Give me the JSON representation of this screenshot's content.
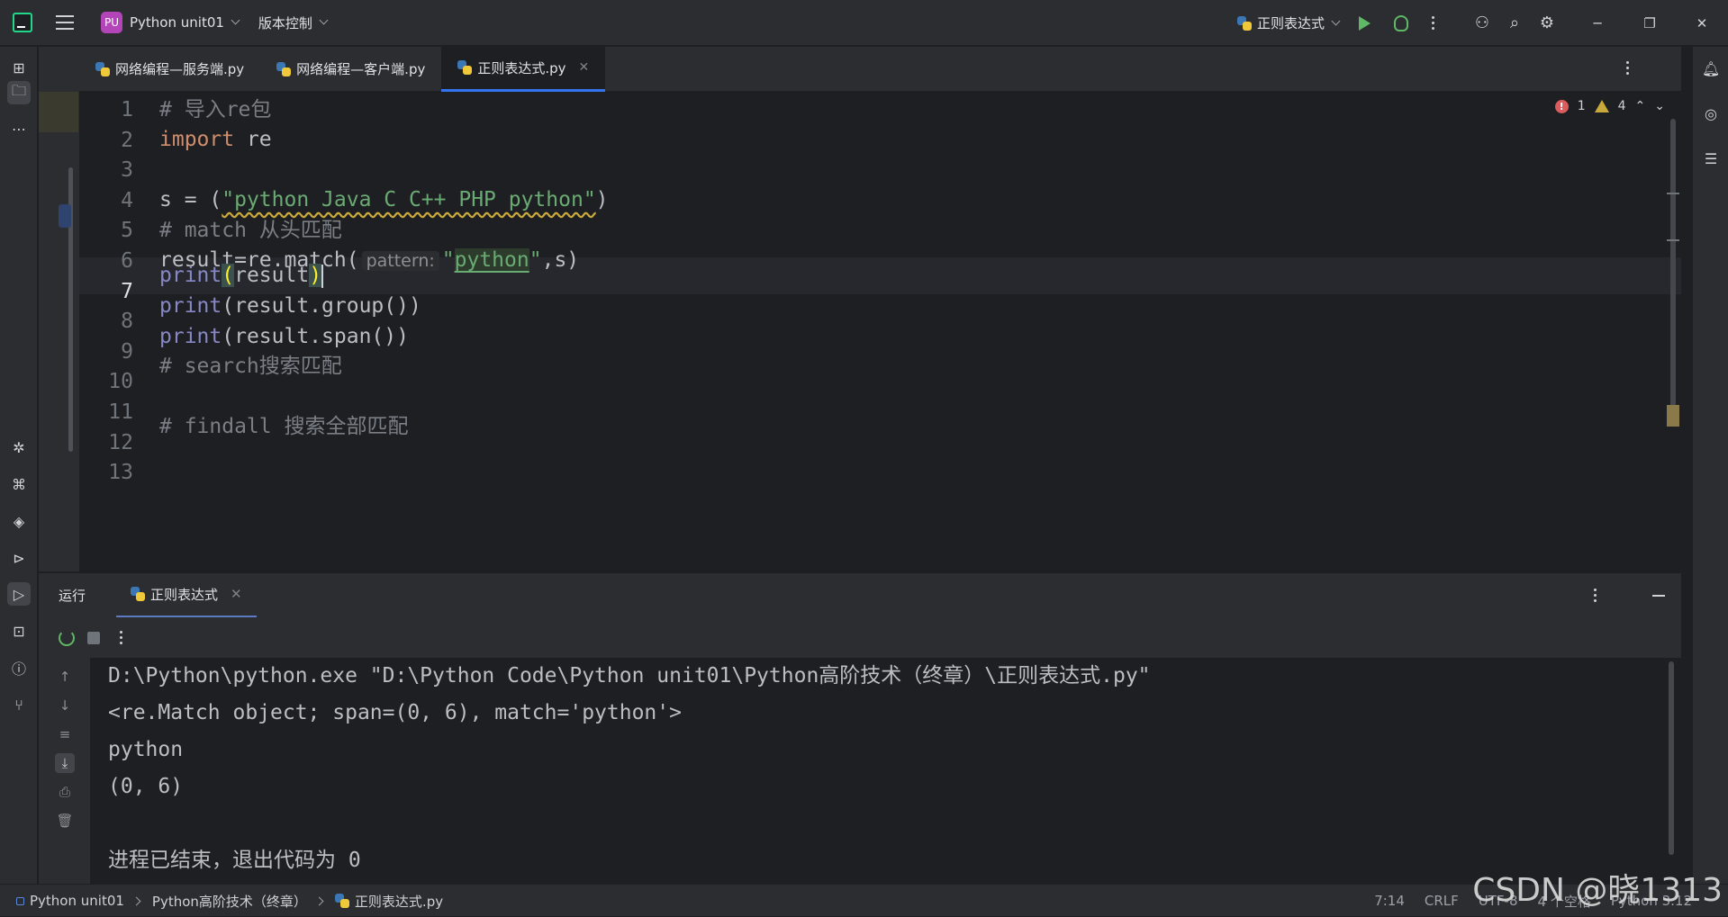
{
  "titlebar": {
    "project_badge": "PU",
    "project_name": "Python unit01",
    "vcs_label": "版本控制",
    "run_config": "正则表达式"
  },
  "tabs": [
    {
      "label": "网络编程—服务端.py",
      "active": false
    },
    {
      "label": "网络编程—客户端.py",
      "active": false
    },
    {
      "label": "正则表达式.py",
      "active": true
    }
  ],
  "editor": {
    "line_numbers": [
      "1",
      "2",
      "3",
      "4",
      "5",
      "6",
      "7",
      "8",
      "9",
      "10",
      "11",
      "12",
      "13"
    ],
    "current_line": 7,
    "inspections": {
      "errors": "1",
      "warnings": "4"
    },
    "lines": {
      "l1_comment": "# 导入re包",
      "l2_kw": "import",
      "l2_rest": " re",
      "l4_pre": "s = (",
      "l4_str": "\"python Java C C++ PHP python\"",
      "l4_post": ")",
      "l5_comment": "# match 从头匹配",
      "l6_pre": "result=re.match(",
      "l6_hint": "pattern:",
      "l6_q1": "\"",
      "l6_str": "python",
      "l6_q2": "\"",
      "l6_post": ",s)",
      "l7_fn": "print",
      "l7_open": "(",
      "l7_arg": "result",
      "l7_close": ")",
      "l8_fn": "print",
      "l8_rest": "(result.group())",
      "l9_fn": "print",
      "l9_rest": "(result.span())",
      "l10_comment": "# search搜索匹配",
      "l12_comment": "# findall 搜索全部匹配"
    }
  },
  "run_panel": {
    "title": "运行",
    "tab_label": "正则表达式",
    "output": [
      "D:\\Python\\python.exe \"D:\\Python Code\\Python unit01\\Python高阶技术（终章）\\正则表达式.py\"",
      "<re.Match object; span=(0, 6), match='python'>",
      "python",
      "(0, 6)",
      "",
      "进程已结束，退出代码为 0"
    ]
  },
  "statusbar": {
    "crumbs": [
      "Python unit01",
      "Python高阶技术（终章）",
      "正则表达式.py"
    ],
    "position": "7:14",
    "line_sep": "CRLF",
    "encoding": "UTF-8",
    "indent": "4 个空格",
    "interpreter": "Python 3.12"
  },
  "watermark": "CSDN @晓1313",
  "icons": [
    "hamburger-icon",
    "run-icon",
    "debug-icon",
    "add-user-icon",
    "search-icon",
    "settings-icon",
    "notifications-icon",
    "database-icon",
    "python-icon"
  ],
  "colors": {
    "accent": "#3574f0",
    "run_green": "#5fb865",
    "python_blue": "#3b77b5",
    "python_yellow": "#f0c93a"
  }
}
